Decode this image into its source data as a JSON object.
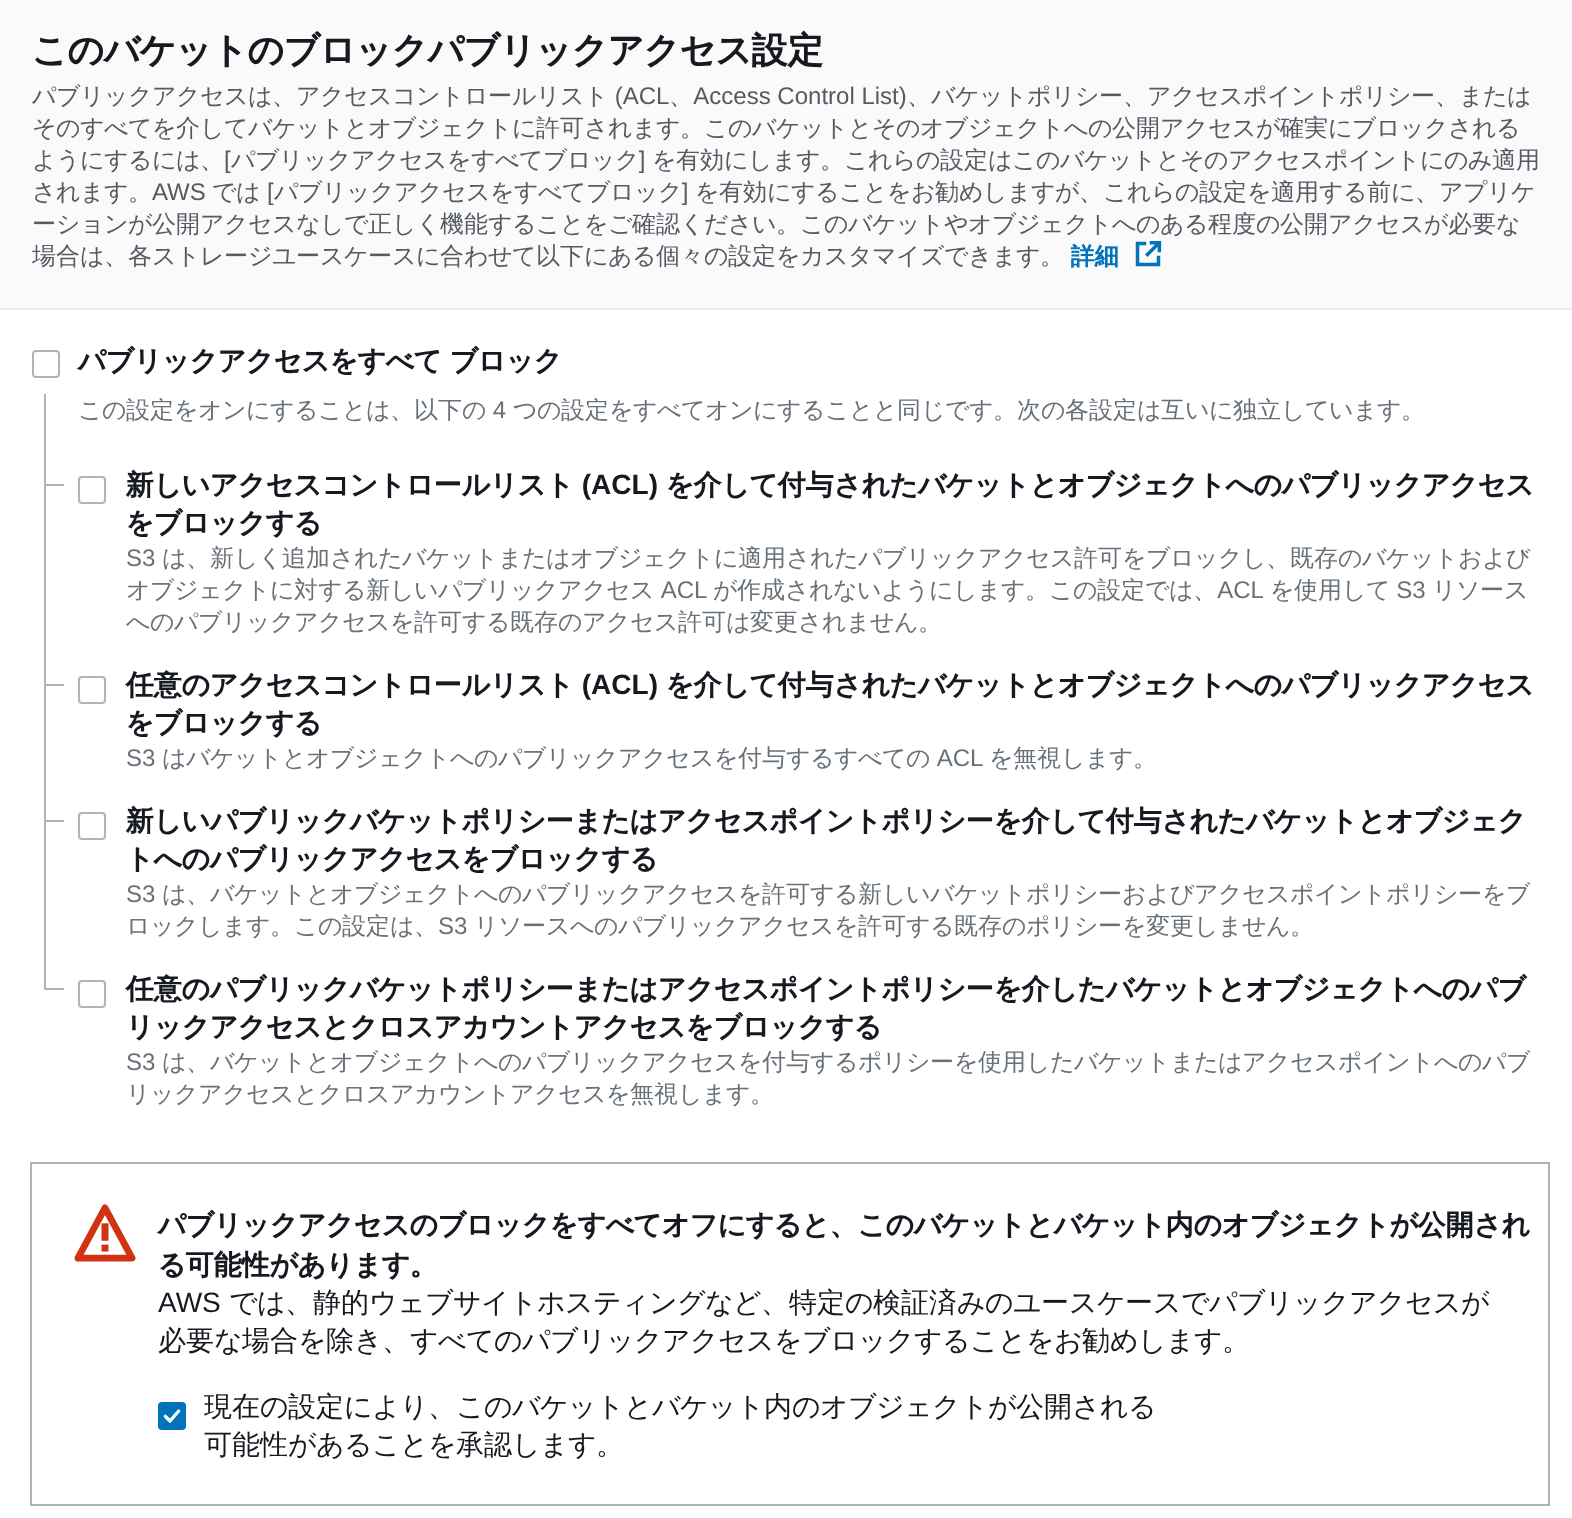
{
  "header": {
    "title": "このバケットのブロックパブリックアクセス設定",
    "description": "パブリックアクセスは、アクセスコントロールリスト (ACL、Access Control List)、バケットポリシー、アクセスポイントポリシー、またはそのすべてを介してバケットとオブジェクトに許可されます。このバケットとそのオブジェクトへの公開アクセスが確実にブロックされるようにするには、[パブリックアクセスをすべてブロック] を有効にします。これらの設定はこのバケットとそのアクセスポイントにのみ適用されます。AWS では [パブリックアクセスをすべてブロック] を有効にすることをお勧めしますが、これらの設定を適用する前に、アプリケーションが公開アクセスなしで正しく機能することをご確認ください。このバケットやオブジェクトへのある程度の公開アクセスが必要な場合は、各ストレージユースケースに合わせて以下にある個々の設定をカスタマイズできます。",
    "link": "詳細"
  },
  "block_all": {
    "label": "パブリックアクセスをすべて ブロック",
    "checked": false,
    "description": "この設定をオンにすることは、以下の 4 つの設定をすべてオンにすることと同じです。次の各設定は互いに独立しています。"
  },
  "options": [
    {
      "label": "新しいアクセスコントロールリスト (ACL) を介して付与されたバケットとオブジェクトへのパブリックアクセスをブロックする",
      "checked": false,
      "description": "S3 は、新しく追加されたバケットまたはオブジェクトに適用されたパブリックアクセス許可をブロックし、既存のバケットおよびオブジェクトに対する新しいパブリックアクセス ACL が作成されないようにします。この設定では、ACL を使用して S3 リソースへのパブリックアクセスを許可する既存のアクセス許可は変更されません。"
    },
    {
      "label": "任意のアクセスコントロールリスト (ACL) を介して付与されたバケットとオブジェクトへのパブリックアクセスをブロックする",
      "checked": false,
      "description": "S3 はバケットとオブジェクトへのパブリックアクセスを付与するすべての ACL を無視します。"
    },
    {
      "label": "新しいパブリックバケットポリシーまたはアクセスポイントポリシーを介して付与されたバケットとオブジェクトへのパブリックアクセスをブロックする",
      "checked": false,
      "description": "S3 は、バケットとオブジェクトへのパブリックアクセスを許可する新しいバケットポリシーおよびアクセスポイントポリシーをブロックします。この設定は、S3 リソースへのパブリックアクセスを許可する既存のポリシーを変更しません。"
    },
    {
      "label": "任意のパブリックバケットポリシーまたはアクセスポイントポリシーを介したバケットとオブジェクトへのパブリックアクセスとクロスアカウントアクセスをブロックする",
      "checked": false,
      "description": "S3 は、バケットとオブジェクトへのパブリックアクセスを付与するポリシーを使用したバケットまたはアクセスポイントへのパブリックアクセスとクロスアカウントアクセスを無視します。"
    }
  ],
  "warning": {
    "title": "パブリックアクセスのブロックをすべてオフにすると、このバケットとバケット内のオブジェクトが公開される可能性があります。",
    "body": "AWS では、静的ウェブサイトホスティングなど、特定の検証済みのユースケースでパブリックアクセスが必要な場合を除き、すべてのパブリックアクセスをブロックすることをお勧めします。",
    "acknowledgement": {
      "label": "現在の設定により、このバケットとバケット内のオブジェクトが公開される可能性があることを承認します。",
      "checked": true
    }
  }
}
